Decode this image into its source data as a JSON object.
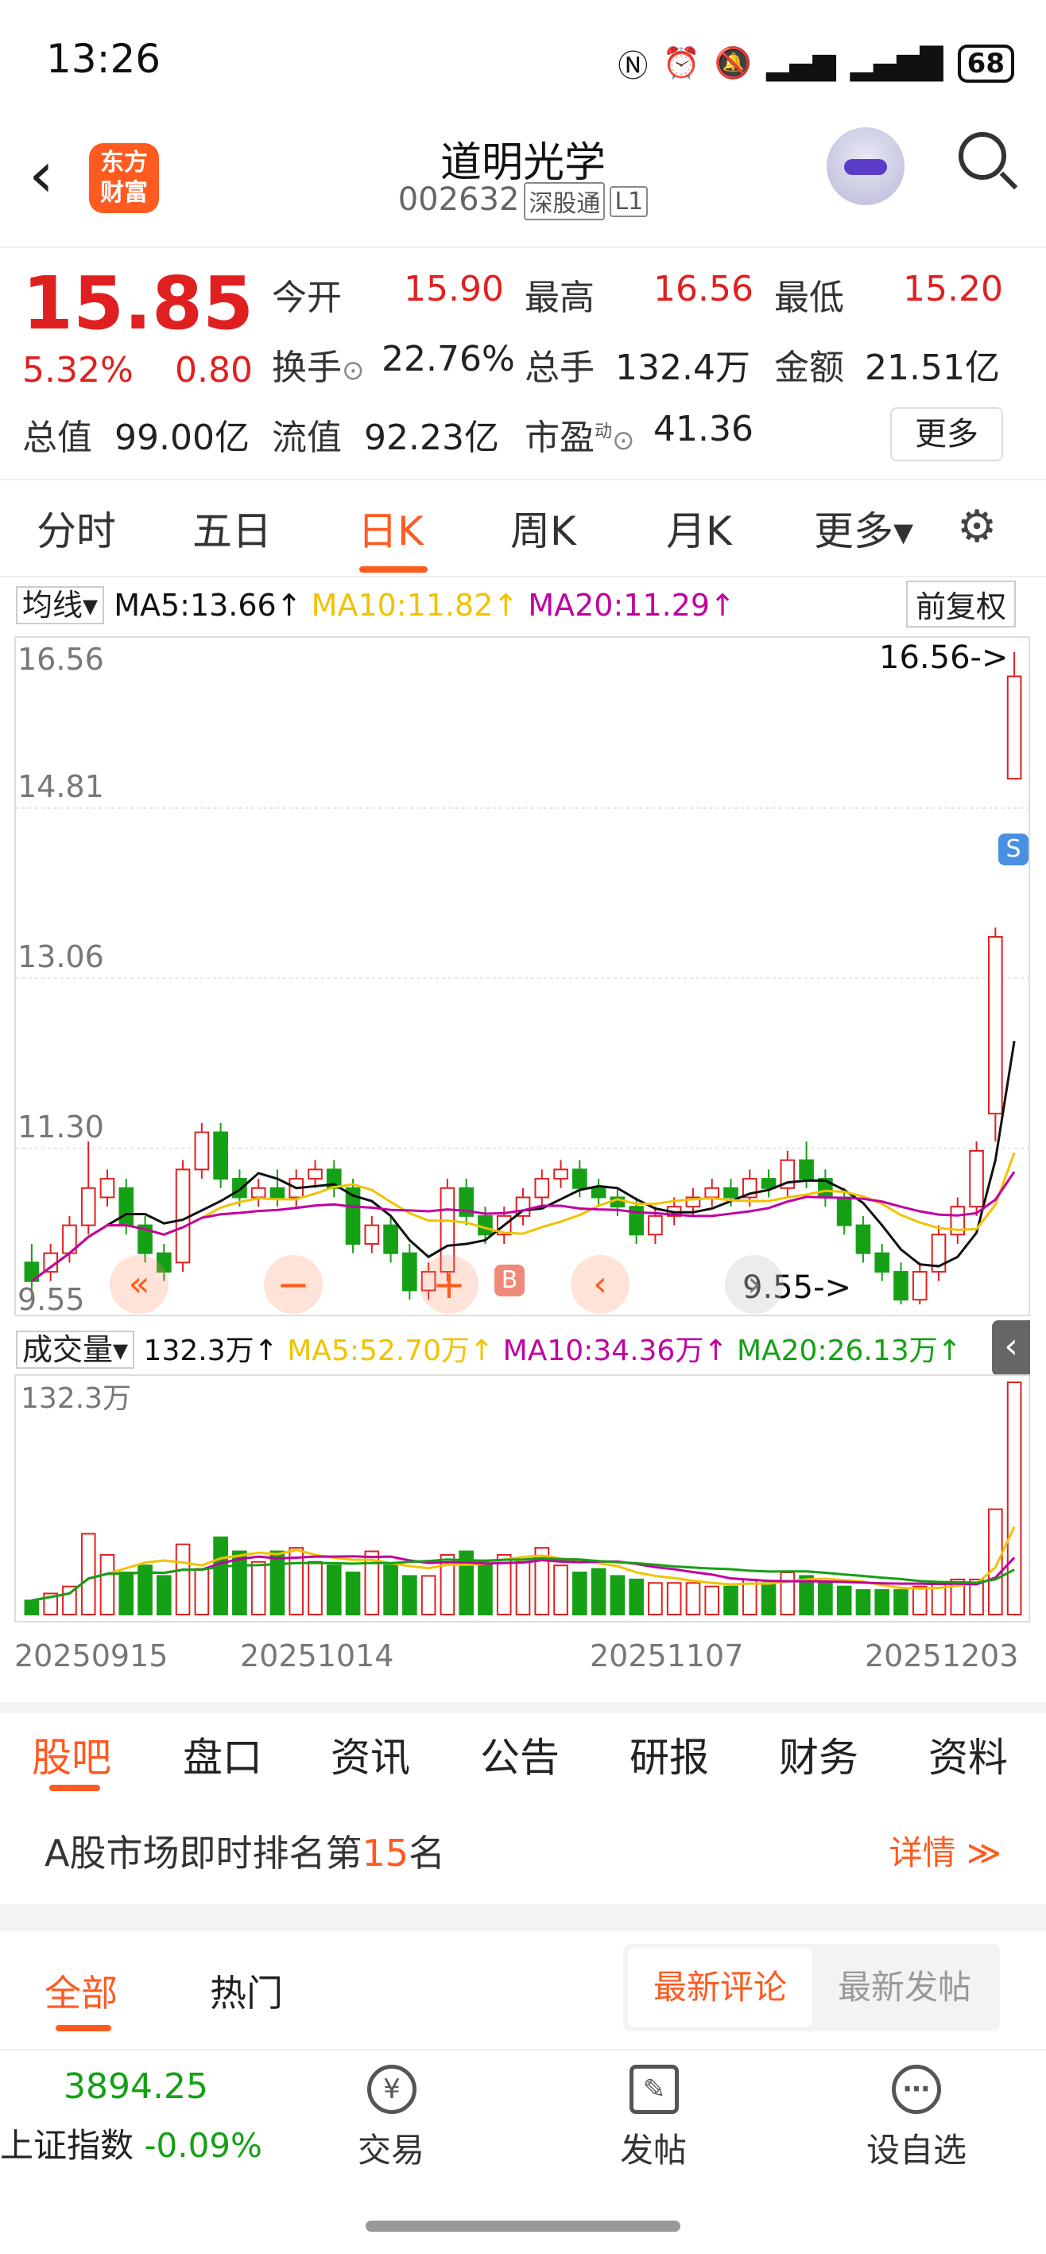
{
  "status_bar": {
    "time": "13:26",
    "battery": "68"
  },
  "header": {
    "logo_line1": "东方",
    "logo_line2": "财富",
    "stock_name": "道明光学",
    "stock_code": "002632",
    "tag1": "深股通",
    "tag2": "L1"
  },
  "quote": {
    "price": "15.85",
    "change_pct": "5.32%",
    "change_amt": "0.80",
    "open_label": "今开",
    "open": "15.90",
    "high_label": "最高",
    "high": "16.56",
    "low_label": "最低",
    "low": "15.20",
    "turnover_label": "换手",
    "turnover": "22.76%",
    "volume_label": "总手",
    "volume": "132.4万",
    "amount_label": "金额",
    "amount": "21.51亿",
    "mktcap_label": "总值",
    "mktcap": "99.00亿",
    "float_label": "流值",
    "float": "92.23亿",
    "pe_label": "市盈",
    "pe_sup": "动",
    "pe": "41.36",
    "more": "更多"
  },
  "chart_tabs": [
    {
      "label": "分时"
    },
    {
      "label": "五日"
    },
    {
      "label": "日K",
      "active": true
    },
    {
      "label": "周K"
    },
    {
      "label": "月K"
    },
    {
      "label": "更多▾"
    }
  ],
  "ma_bar": {
    "select": "均线",
    "ma5": "MA5:13.66↑",
    "ma10": "MA10:11.82↑",
    "ma20": "MA20:11.29↑",
    "adjust": "前复权"
  },
  "price_axis": [
    "16.56",
    "14.81",
    "13.06",
    "11.30",
    "9.55"
  ],
  "annotations": {
    "max": "16.56->",
    "min": "9.55->",
    "buy": "B",
    "sell": "S"
  },
  "vol_bar": {
    "select": "成交量",
    "vol": "132.3万↑",
    "ma5": "MA5:52.70万↑",
    "ma10": "MA10:34.36万↑",
    "ma20": "MA20:26.13万↑",
    "max_label": "132.3万"
  },
  "dates": [
    "20250915",
    "20251014",
    "20251107",
    "20251203"
  ],
  "colors": {
    "up": "#e02020",
    "down": "#16a016",
    "ma5": "#111111",
    "ma10": "#f2c200",
    "ma20": "#c000a0",
    "accent": "#ff5a1f"
  },
  "chart_data": {
    "type": "candlestick",
    "ylim": [
      9.55,
      16.56
    ],
    "candles": [
      [
        10.0,
        9.8,
        10.2,
        9.7
      ],
      [
        9.9,
        10.1,
        10.2,
        9.8
      ],
      [
        10.1,
        10.4,
        10.5,
        10.0
      ],
      [
        10.4,
        10.8,
        11.3,
        10.3
      ],
      [
        10.7,
        10.9,
        11.0,
        10.6
      ],
      [
        10.8,
        10.4,
        10.9,
        10.3
      ],
      [
        10.4,
        10.1,
        10.5,
        10.0
      ],
      [
        10.1,
        9.9,
        10.2,
        9.8
      ],
      [
        10.0,
        11.0,
        11.1,
        9.9
      ],
      [
        11.0,
        11.4,
        11.5,
        10.9
      ],
      [
        11.4,
        10.9,
        11.5,
        10.8
      ],
      [
        10.9,
        10.7,
        11.0,
        10.6
      ],
      [
        10.7,
        10.8,
        10.9,
        10.6
      ],
      [
        10.8,
        10.7,
        11.0,
        10.6
      ],
      [
        10.7,
        10.9,
        11.0,
        10.6
      ],
      [
        10.9,
        11.0,
        11.1,
        10.8
      ],
      [
        11.0,
        10.8,
        11.1,
        10.7
      ],
      [
        10.8,
        10.2,
        10.9,
        10.1
      ],
      [
        10.2,
        10.4,
        10.5,
        10.1
      ],
      [
        10.4,
        10.1,
        10.5,
        10.0
      ],
      [
        10.1,
        9.7,
        10.2,
        9.6
      ],
      [
        9.7,
        9.9,
        10.0,
        9.6
      ],
      [
        9.9,
        10.8,
        10.9,
        9.8
      ],
      [
        10.8,
        10.5,
        10.9,
        10.4
      ],
      [
        10.5,
        10.3,
        10.6,
        10.2
      ],
      [
        10.3,
        10.5,
        10.6,
        10.2
      ],
      [
        10.5,
        10.7,
        10.8,
        10.4
      ],
      [
        10.7,
        10.9,
        11.0,
        10.6
      ],
      [
        10.9,
        11.0,
        11.1,
        10.8
      ],
      [
        11.0,
        10.8,
        11.1,
        10.7
      ],
      [
        10.8,
        10.7,
        10.9,
        10.6
      ],
      [
        10.7,
        10.6,
        10.8,
        10.5
      ],
      [
        10.6,
        10.3,
        10.7,
        10.2
      ],
      [
        10.3,
        10.5,
        10.6,
        10.2
      ],
      [
        10.5,
        10.6,
        10.7,
        10.4
      ],
      [
        10.6,
        10.7,
        10.8,
        10.5
      ],
      [
        10.7,
        10.8,
        10.9,
        10.6
      ],
      [
        10.8,
        10.7,
        10.9,
        10.6
      ],
      [
        10.7,
        10.9,
        11.0,
        10.6
      ],
      [
        10.9,
        10.8,
        11.0,
        10.7
      ],
      [
        10.8,
        11.1,
        11.2,
        10.7
      ],
      [
        11.1,
        10.9,
        11.3,
        10.8
      ],
      [
        10.9,
        10.7,
        11.0,
        10.6
      ],
      [
        10.7,
        10.4,
        10.8,
        10.3
      ],
      [
        10.4,
        10.1,
        10.5,
        10.0
      ],
      [
        10.1,
        9.9,
        10.2,
        9.8
      ],
      [
        9.9,
        9.6,
        10.0,
        9.55
      ],
      [
        9.6,
        9.9,
        10.0,
        9.55
      ],
      [
        9.9,
        10.3,
        10.4,
        9.8
      ],
      [
        10.3,
        10.6,
        10.7,
        10.2
      ],
      [
        10.6,
        11.2,
        11.3,
        10.5
      ],
      [
        11.6,
        13.5,
        13.6,
        11.3
      ],
      [
        15.2,
        16.3,
        16.56,
        15.2
      ]
    ],
    "volume_unit": "万",
    "volumes": [
      8,
      12,
      16,
      46,
      34,
      24,
      28,
      22,
      40,
      26,
      44,
      36,
      30,
      36,
      38,
      30,
      28,
      24,
      36,
      28,
      22,
      22,
      34,
      36,
      30,
      34,
      30,
      38,
      28,
      24,
      26,
      22,
      20,
      18,
      18,
      18,
      16,
      16,
      20,
      18,
      24,
      22,
      18,
      16,
      14,
      14,
      14,
      16,
      18,
      20,
      20,
      60,
      132.3
    ]
  }
}
